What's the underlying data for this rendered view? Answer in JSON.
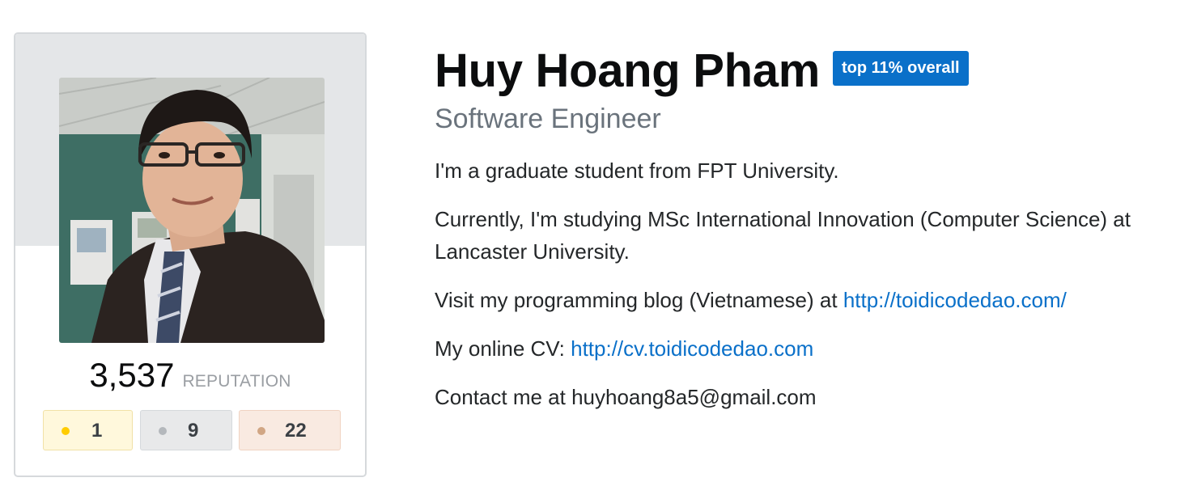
{
  "profile": {
    "name": "Huy Hoang Pham",
    "rank_badge": "top 11% overall",
    "title": "Software Engineer",
    "reputation_value": "3,537",
    "reputation_label": "REPUTATION",
    "badges": {
      "gold": "1",
      "silver": "9",
      "bronze": "22"
    }
  },
  "about": {
    "line1": "I'm a graduate student from FPT University.",
    "line2": "Currently, I'm studying MSc International Innovation (Computer Science) at Lancaster University.",
    "line3_prefix": "Visit my programming blog (Vietnamese) at ",
    "blog_link": "http://toidicodedao.com/",
    "line4_prefix": "My online CV: ",
    "cv_link": "http://cv.toidicodedao.com",
    "line5": "Contact me at huyhoang8a5@gmail.com"
  },
  "colors": {
    "accent": "#0a70c9",
    "gold": "#ffcc01",
    "silver": "#b4b8bc",
    "bronze": "#d1a684"
  }
}
